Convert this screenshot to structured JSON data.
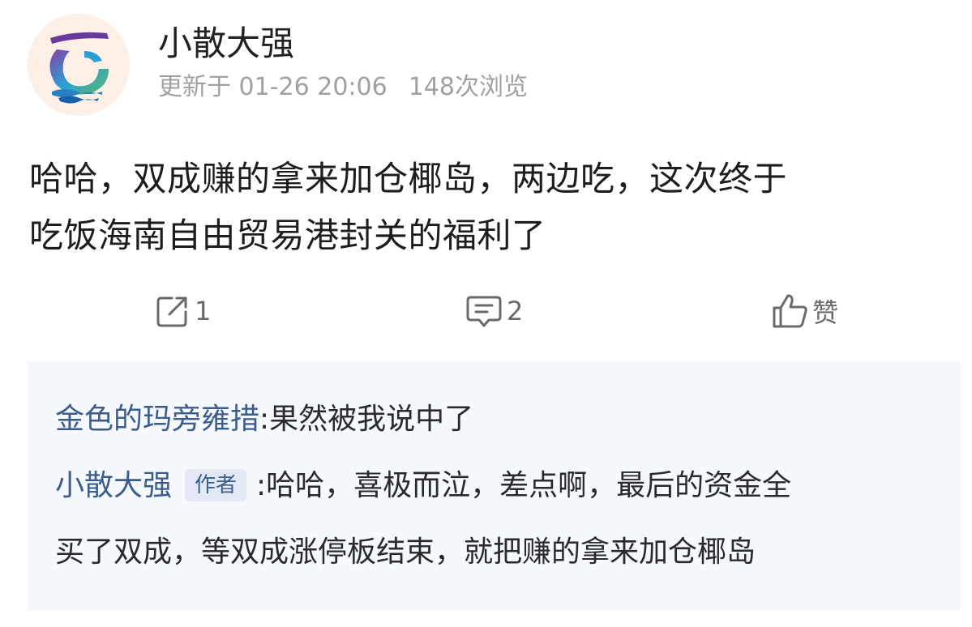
{
  "header": {
    "username": "小散大强",
    "updated": "更新于 01-26 20:06",
    "views": "148次浏览"
  },
  "post": {
    "line1": "哈哈，双成赚的拿来加仓椰岛，两边吃，这次终于",
    "line2": "吃饭海南自由贸易港封关的福利了"
  },
  "actions": {
    "repost_icon": "share-icon",
    "repost_count": "1",
    "comment_icon": "comment-icon",
    "comment_count": "2",
    "like_icon": "thumbs-up-icon",
    "like_label": "赞"
  },
  "comments": [
    {
      "author": "金色的玛旁雍措",
      "separator": ":",
      "text": "果然被我说中了"
    },
    {
      "author": "小散大强",
      "badge": "作者",
      "separator": ":",
      "text_line1": "哈哈，喜极而泣，差点啊，最后的资金全",
      "text_line2": "买了双成，等双成涨停板结束，就把赚的拿来加仓椰岛"
    }
  ],
  "colors": {
    "author_blue": "#3c5c8c",
    "meta_gray": "#a0a0a0",
    "panel_bg": "#f5f8fd"
  }
}
